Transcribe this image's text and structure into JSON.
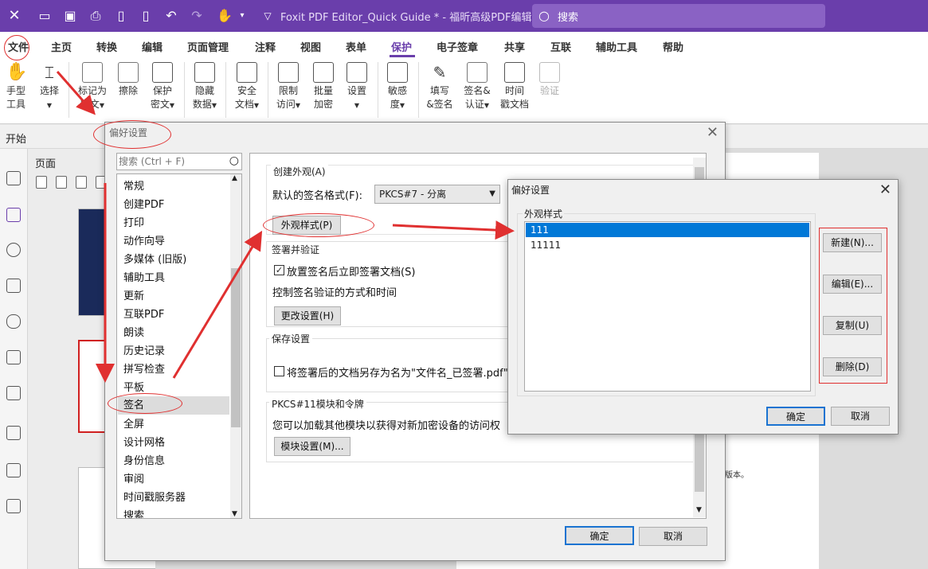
{
  "titlebar": {
    "title": "Foxit PDF Editor_Quick Guide * - 福昕高级PDF编辑器",
    "search_placeholder": "搜索"
  },
  "menubar": {
    "items": [
      "文件",
      "主页",
      "转换",
      "编辑",
      "页面管理",
      "注释",
      "视图",
      "表单",
      "保护",
      "电子签章",
      "共享",
      "互联",
      "辅助工具",
      "帮助"
    ],
    "active": "保护"
  },
  "ribbon": {
    "hand": [
      "手型",
      "工具"
    ],
    "select": "选择",
    "mark": [
      "标记为",
      "密文"
    ],
    "erase": "擦除",
    "protect": [
      "保护",
      "密文"
    ],
    "hide": [
      "隐藏",
      "数据"
    ],
    "secure": [
      "安全",
      "文档"
    ],
    "restrict": [
      "限制",
      "访问"
    ],
    "batch": [
      "批量",
      "加密"
    ],
    "settings": "设置",
    "sensitive": [
      "敏感",
      "度"
    ],
    "fill": [
      "填写",
      "&签名"
    ],
    "sign": [
      "签名&",
      "认证"
    ],
    "timestamp": [
      "时间",
      "戳文档"
    ],
    "verify": "验证"
  },
  "start_label": "开始",
  "page_panel_label": "页面",
  "doc_snippet": "版本。",
  "pref_dialog": {
    "title": "偏好设置",
    "search_placeholder": "搜索 (Ctrl + F)",
    "categories": [
      "常规",
      "创建PDF",
      "打印",
      "动作向导",
      "多媒体 (旧版)",
      "辅助工具",
      "更新",
      "互联PDF",
      "朗读",
      "历史记录",
      "拼写检查",
      "平板",
      "签名",
      "全屏",
      "设计网格",
      "身份信息",
      "审阅",
      "时间戳服务器",
      "搜索"
    ],
    "selected_category": "签名",
    "create_appearance": {
      "title": "创建外观(A)",
      "format_label": "默认的签名格式(F):",
      "format_value": "PKCS#7 - 分离",
      "appearance_button": "外观样式(P)"
    },
    "sign_verify": {
      "title": "签署并验证",
      "checkbox_label": "放置签名后立即签署文档(S)",
      "checked": true,
      "control_text": "控制签名验证的方式和时间",
      "change_button": "更改设置(H)"
    },
    "save_settings": {
      "title": "保存设置",
      "checkbox_label": "将签署后的文档另存为名为\"文件名_已签署.pdf\"的",
      "checked": false
    },
    "pkcs": {
      "title": "PKCS#11模块和令牌",
      "text": "您可以加载其他模块以获得对新加密设备的访问权",
      "module_button": "模块设置(M)..."
    },
    "ok": "确定",
    "cancel": "取消"
  },
  "appearance_dialog": {
    "title": "偏好设置",
    "group_title": "外观样式",
    "items": [
      "111",
      "11111"
    ],
    "selected": "111",
    "buttons": [
      "新建(N)...",
      "编辑(E)...",
      "复制(U)",
      "删除(D)"
    ],
    "ok": "确定",
    "cancel": "取消"
  }
}
